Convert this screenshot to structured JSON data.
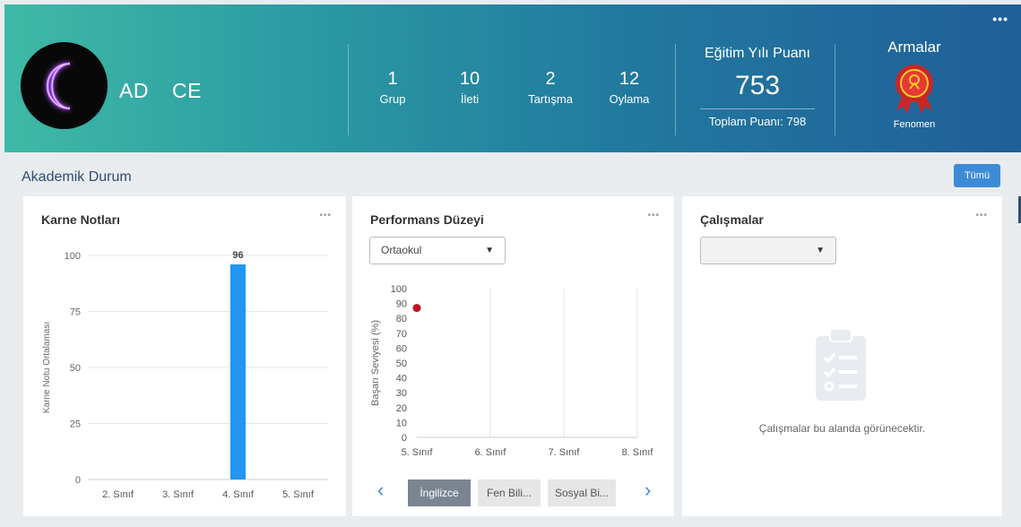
{
  "header": {
    "more": "•••",
    "user": {
      "first": "AD",
      "last": "CE"
    },
    "stats": [
      {
        "num": "1",
        "label": "Grup"
      },
      {
        "num": "10",
        "label": "İleti"
      },
      {
        "num": "2",
        "label": "Tartışma"
      },
      {
        "num": "12",
        "label": "Oylama"
      }
    ],
    "score": {
      "title": "Eğitim Yılı Puanı",
      "value": "753",
      "total": "Toplam Puanı: 798"
    },
    "badges": {
      "title": "Armalar",
      "badge_name": "Fenomen"
    }
  },
  "section": {
    "title": "Akademik Durum",
    "all_button": "Tümü"
  },
  "cards": {
    "karne": {
      "title": "Karne Notları",
      "more": "•••"
    },
    "performans": {
      "title": "Performans Düzeyi",
      "more": "•••",
      "select_value": "Ortaokul",
      "tabs": [
        "İngilizce",
        "Fen Bili...",
        "Sosyal Bi..."
      ],
      "prev": "‹",
      "next": "›"
    },
    "calismalar": {
      "title": "Çalışmalar",
      "more": "•••",
      "select_value": "",
      "empty_text": "Çalışmalar bu alanda görünecektir."
    }
  },
  "icons": {
    "avatar": "moon-icon",
    "badge": "medal-icon",
    "empty": "clipboard-icon",
    "chevron": "chevron-down-icon"
  },
  "colors": {
    "bar": "#2196f3",
    "point": "#c0111f",
    "accent": "#3d8bd6"
  },
  "chart_data": [
    {
      "type": "bar",
      "categories": [
        "2. Sınıf",
        "3. Sınıf",
        "4. Sınıf",
        "5. Sınıf"
      ],
      "values": [
        null,
        null,
        96,
        null
      ],
      "data_labels": [
        "",
        "",
        "96",
        ""
      ],
      "ylabel": "Karne Notu Ortalaması",
      "yticks": [
        0,
        25,
        50,
        75,
        100
      ],
      "ylim": [
        0,
        100
      ],
      "grid": true
    },
    {
      "type": "scatter",
      "categories": [
        "5. Sınıf",
        "6. Sınıf",
        "7. Sınıf",
        "8. Sınıf"
      ],
      "values": [
        87,
        null,
        null,
        null
      ],
      "ylabel": "Başarı Seviyesi (%)",
      "yticks": [
        0,
        10,
        20,
        30,
        40,
        50,
        60,
        70,
        80,
        90,
        100
      ],
      "ylim": [
        0,
        100
      ],
      "grid": true
    }
  ]
}
